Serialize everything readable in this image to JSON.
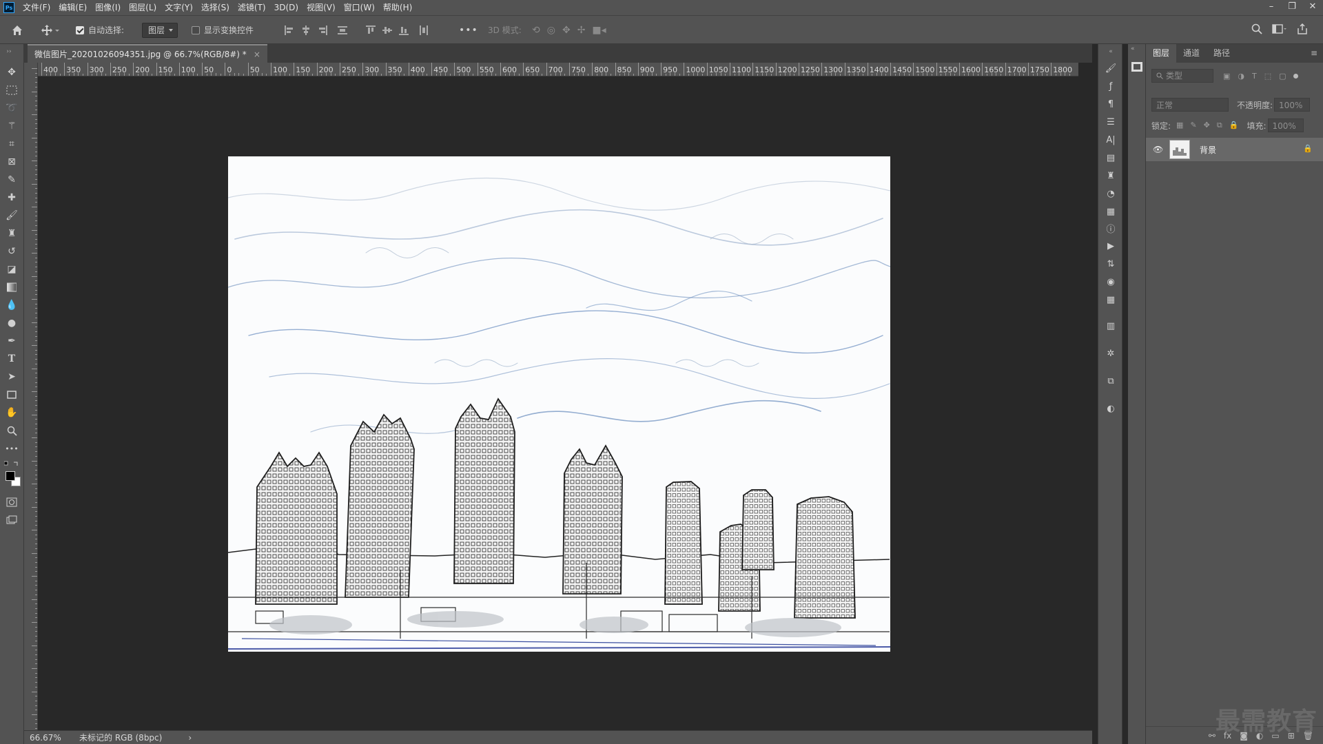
{
  "app": {
    "logo_text": "Ps"
  },
  "menu": [
    "文件(F)",
    "编辑(E)",
    "图像(I)",
    "图层(L)",
    "文字(Y)",
    "选择(S)",
    "滤镜(T)",
    "3D(D)",
    "视图(V)",
    "窗口(W)",
    "帮助(H)"
  ],
  "window_controls": {
    "minimize": "–",
    "restore": "❐",
    "close": "✕"
  },
  "options_bar": {
    "auto_select_label": "自动选择:",
    "auto_select_checked": true,
    "auto_select_target": "图层",
    "show_transform_label": "显示变换控件",
    "show_transform_checked": false,
    "more": "•••",
    "mode_3d_label": "3D 模式:"
  },
  "document": {
    "tab_title": "微信图片_20201026094351.jpg @ 66.7%(RGB/8#) *",
    "tab_close": "×"
  },
  "ruler_top_labels": [
    "400",
    "350",
    "300",
    "250",
    "200",
    "150",
    "100",
    "50",
    "0",
    "50",
    "100",
    "150",
    "200",
    "250",
    "300",
    "350",
    "400",
    "450",
    "500",
    "550",
    "600",
    "650",
    "700",
    "750",
    "800",
    "850",
    "900",
    "950",
    "1000",
    "1050",
    "1100",
    "1150",
    "1200",
    "1250",
    "1300",
    "1350",
    "1400",
    "1450",
    "1500",
    "1550",
    "1600",
    "1650",
    "1700",
    "1750",
    "1800"
  ],
  "status_bar": {
    "zoom": "66.67%",
    "profile": "未标记的 RGB (8bpc)",
    "arrow": "›"
  },
  "layers_panel": {
    "tabs": [
      "图层",
      "通道",
      "路径"
    ],
    "active_tab": "图层",
    "filter_placeholder": "类型",
    "blend_mode": "正常",
    "opacity_label": "不透明度:",
    "opacity_value": "100%",
    "lock_label": "锁定:",
    "fill_label": "填充:",
    "fill_value": "100%",
    "layer_name": "背景"
  },
  "watermark": "最需教育",
  "colors": {
    "ui_bg": "#535353",
    "canvas_bg": "#282828",
    "accent": "#31a8ff"
  }
}
